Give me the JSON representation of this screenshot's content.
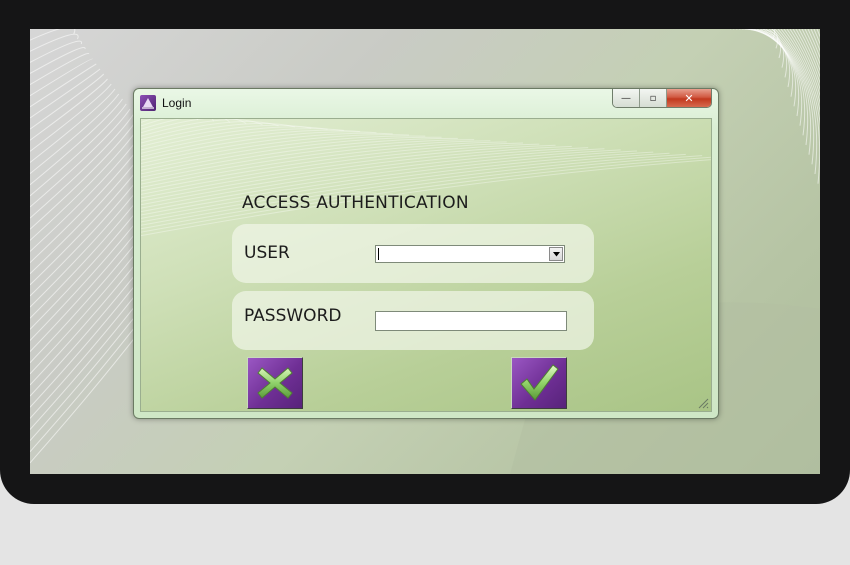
{
  "window": {
    "title": "Login"
  },
  "caption": {
    "minimize": "—",
    "maximize": "▫",
    "close": "✕"
  },
  "form": {
    "heading": "ACCESS AUTHENTICATION",
    "user_label": "USER",
    "user_value": "",
    "password_label": "PASSWORD",
    "password_value": ""
  },
  "icons": {
    "app": "app-logo-icon",
    "cancel": "x-cross-icon",
    "confirm": "checkmark-icon",
    "dropdown": "triangle-down-icon",
    "resize": "resize-grip-icon"
  },
  "colors": {
    "button_purple": "#6f2f95",
    "close_red": "#c2391f",
    "icon_green": "#8fd16a"
  }
}
